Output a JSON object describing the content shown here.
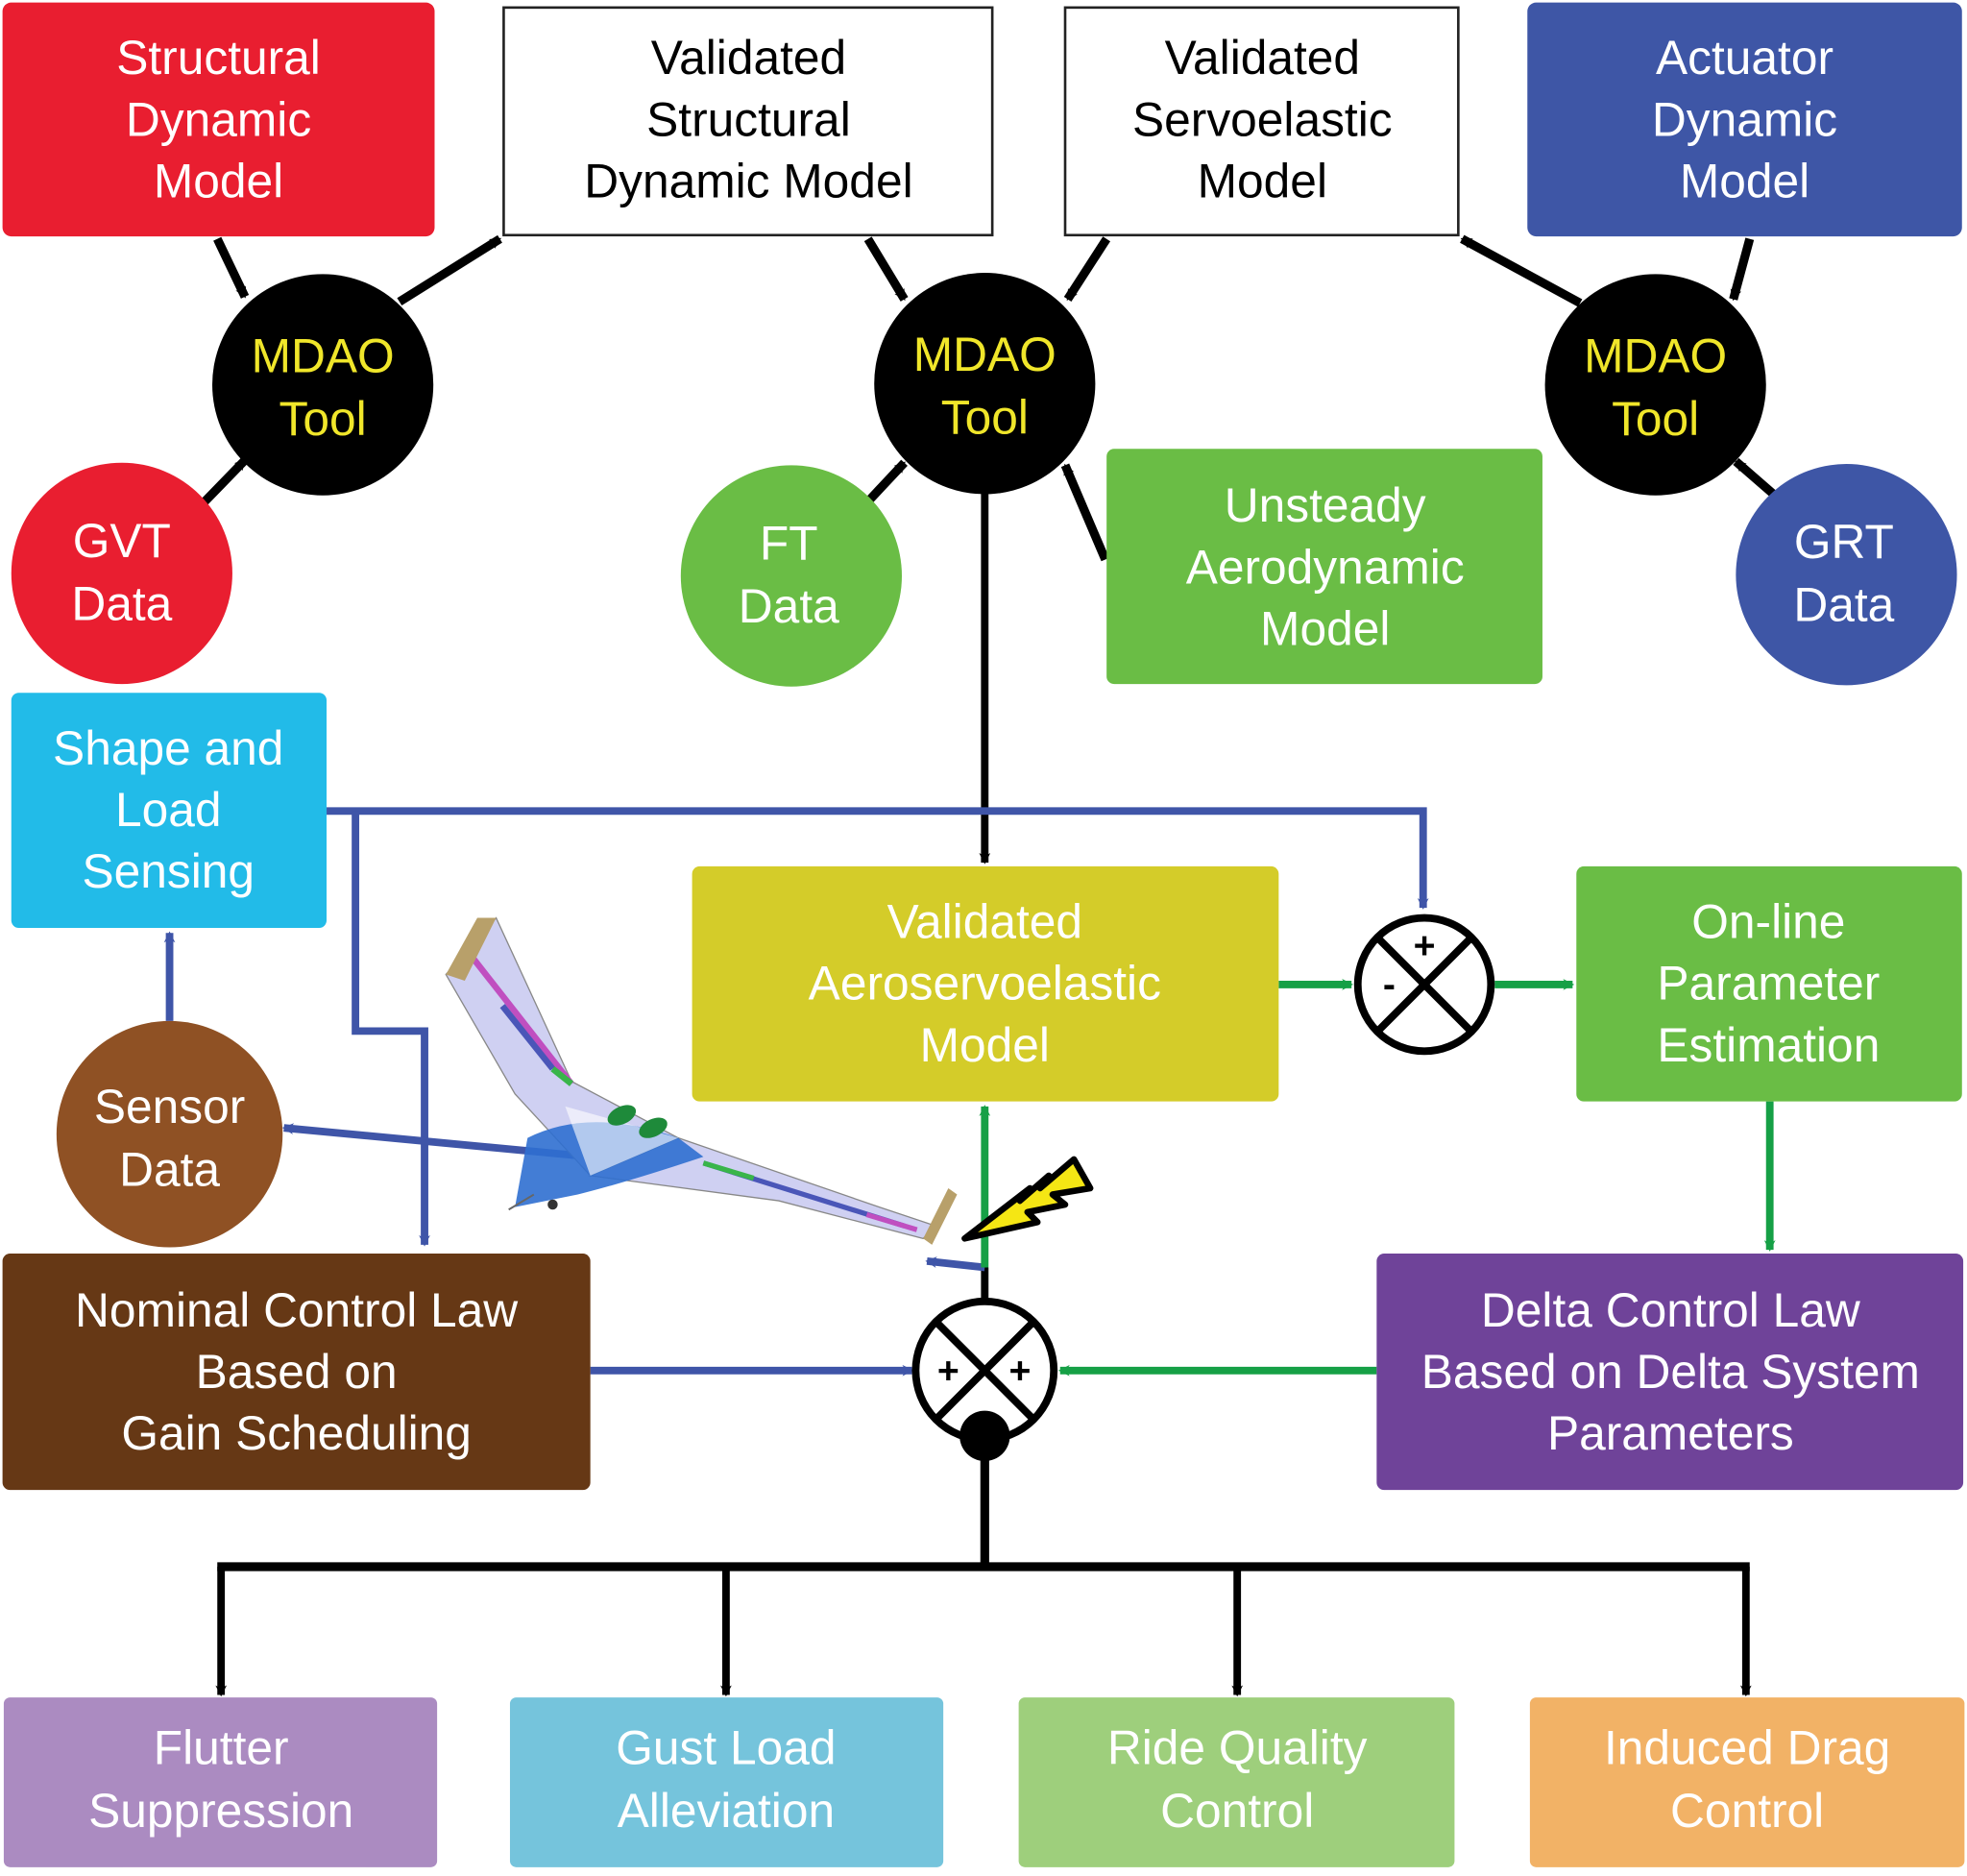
{
  "diagram": {
    "colors": {
      "red": "#e91e30",
      "blue_dark": "#3e56a6",
      "green": "#6abd45",
      "cyan": "#22bbe8",
      "brown_circle": "#8f5124",
      "brown_box": "#663815",
      "yellow_box": "#d4cc29",
      "purple": "#6f4399",
      "flutter": "#ab8bc1",
      "gust": "#75c4dc",
      "ride": "#9ecf7c",
      "drag": "#f2b266",
      "line_blue": "#3f55a8",
      "line_green": "#16a046",
      "mdao_text": "#f0e62a"
    },
    "nodes": {
      "structural_dynamic_model": [
        "Structural",
        "Dynamic",
        "Model"
      ],
      "validated_structural_dynamic_model": [
        "Validated",
        "Structural",
        "Dynamic Model"
      ],
      "validated_servoelastic_model": [
        "Validated",
        "Servoelastic",
        "Model"
      ],
      "actuator_dynamic_model": [
        "Actuator",
        "Dynamic",
        "Model"
      ],
      "mdao_tool_1": [
        "MDAO",
        "Tool"
      ],
      "mdao_tool_2": [
        "MDAO",
        "Tool"
      ],
      "mdao_tool_3": [
        "MDAO",
        "Tool"
      ],
      "gvt_data": [
        "GVT",
        "Data"
      ],
      "ft_data": [
        "FT",
        "Data"
      ],
      "grt_data": [
        "GRT",
        "Data"
      ],
      "unsteady_aerodynamic_model": [
        "Unsteady",
        "Aerodynamic",
        "Model"
      ],
      "shape_and_load_sensing": [
        "Shape and",
        "Load",
        "Sensing"
      ],
      "validated_aeroservoelastic_model": [
        "Validated",
        "Aeroservoelastic",
        "Model"
      ],
      "online_parameter_estimation": [
        "On-line",
        "Parameter",
        "Estimation"
      ],
      "sensor_data": [
        "Sensor",
        "Data"
      ],
      "nominal_control_law": [
        "Nominal Control Law",
        "Based on",
        "Gain Scheduling"
      ],
      "delta_control_law": [
        "Delta Control Law",
        "Based on Delta System",
        "Parameters"
      ],
      "flutter_suppression": [
        "Flutter",
        "Suppression"
      ],
      "gust_load_alleviation": [
        "Gust Load",
        "Alleviation"
      ],
      "ride_quality_control": [
        "Ride Quality",
        "Control"
      ],
      "induced_drag_control": [
        "Induced Drag",
        "Control"
      ]
    },
    "summing_junctions": {
      "comparator": {
        "top": "+",
        "left": "-"
      },
      "adder": {
        "left": "+",
        "right": "+"
      }
    },
    "icons": {
      "aircraft": "blended-wing-body-aircraft-icon",
      "lightning": "lightning-bolt-icon"
    }
  }
}
